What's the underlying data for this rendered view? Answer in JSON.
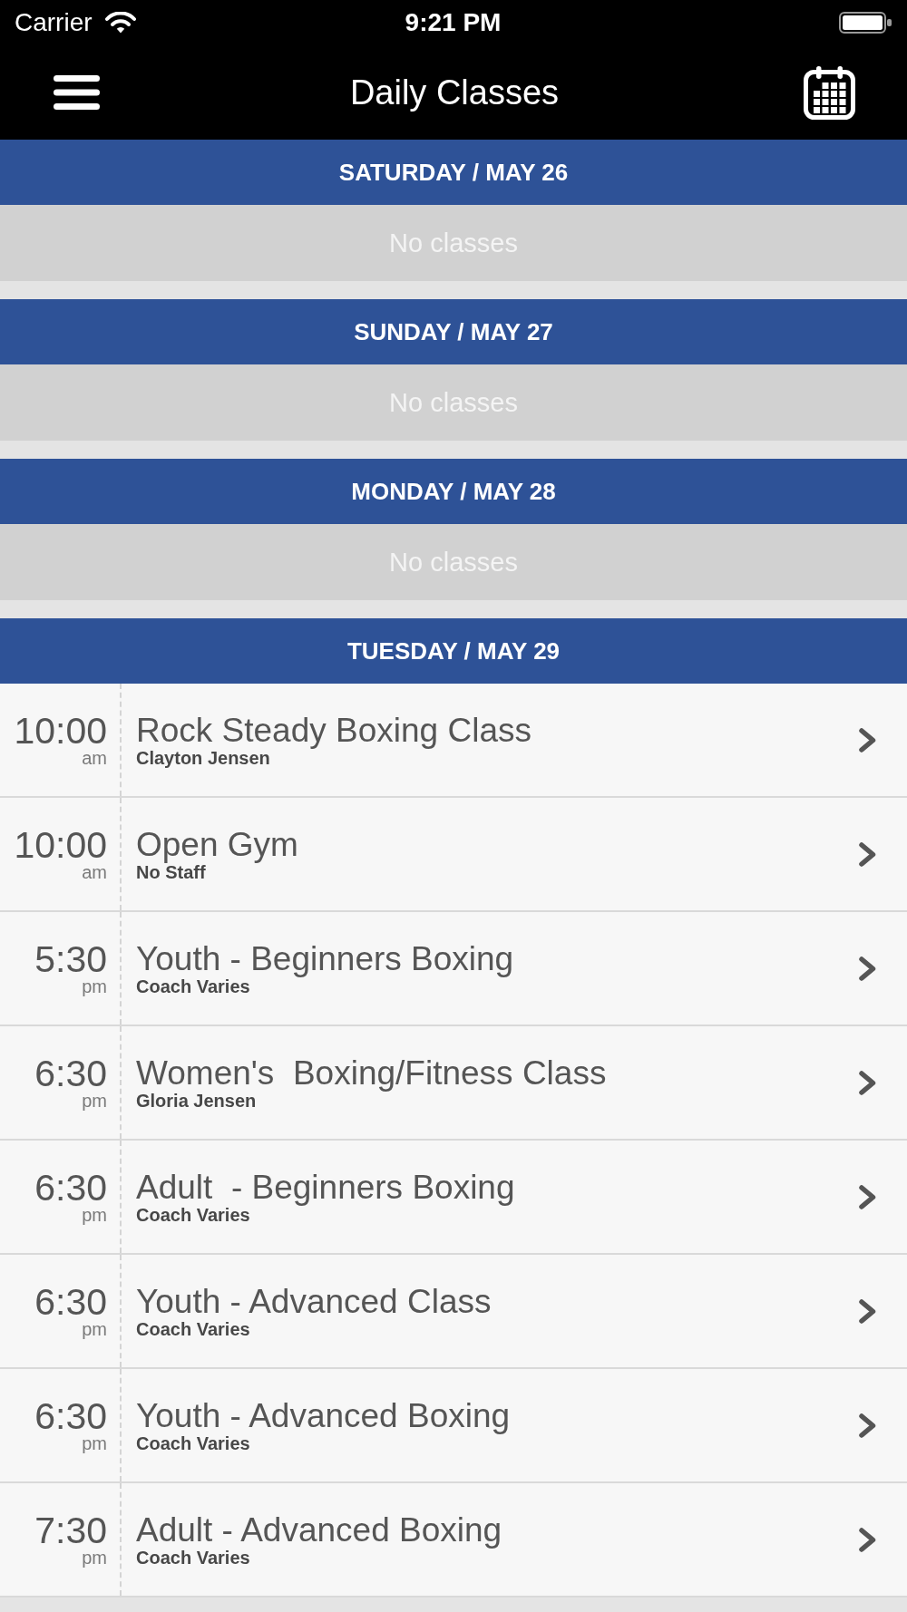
{
  "status_bar": {
    "carrier": "Carrier",
    "time": "9:21 PM"
  },
  "nav_bar": {
    "title": "Daily Classes"
  },
  "days": [
    {
      "header": "SATURDAY / MAY 26",
      "empty_text": "No classes"
    },
    {
      "header": "SUNDAY / MAY 27",
      "empty_text": "No classes"
    },
    {
      "header": "MONDAY / MAY 28",
      "empty_text": "No classes"
    },
    {
      "header": "TUESDAY / MAY 29",
      "classes": [
        {
          "time": "10:00",
          "period": "am",
          "title": "Rock Steady Boxing Class",
          "instructor": "Clayton Jensen"
        },
        {
          "time": "10:00",
          "period": "am",
          "title": "Open Gym",
          "instructor": "No Staff"
        },
        {
          "time": "5:30",
          "period": "pm",
          "title": "Youth - Beginners Boxing",
          "instructor": "Coach Varies"
        },
        {
          "time": "6:30",
          "period": "pm",
          "title": "Women's  Boxing/Fitness Class",
          "instructor": "Gloria Jensen"
        },
        {
          "time": "6:30",
          "period": "pm",
          "title": "Adult  - Beginners Boxing",
          "instructor": "Coach Varies"
        },
        {
          "time": "6:30",
          "period": "pm",
          "title": "Youth - Advanced Class",
          "instructor": "Coach Varies"
        },
        {
          "time": "6:30",
          "period": "pm",
          "title": "Youth - Advanced Boxing",
          "instructor": "Coach Varies"
        },
        {
          "time": "7:30",
          "period": "pm",
          "title": "Adult - Advanced Boxing",
          "instructor": "Coach Varies"
        }
      ]
    }
  ]
}
